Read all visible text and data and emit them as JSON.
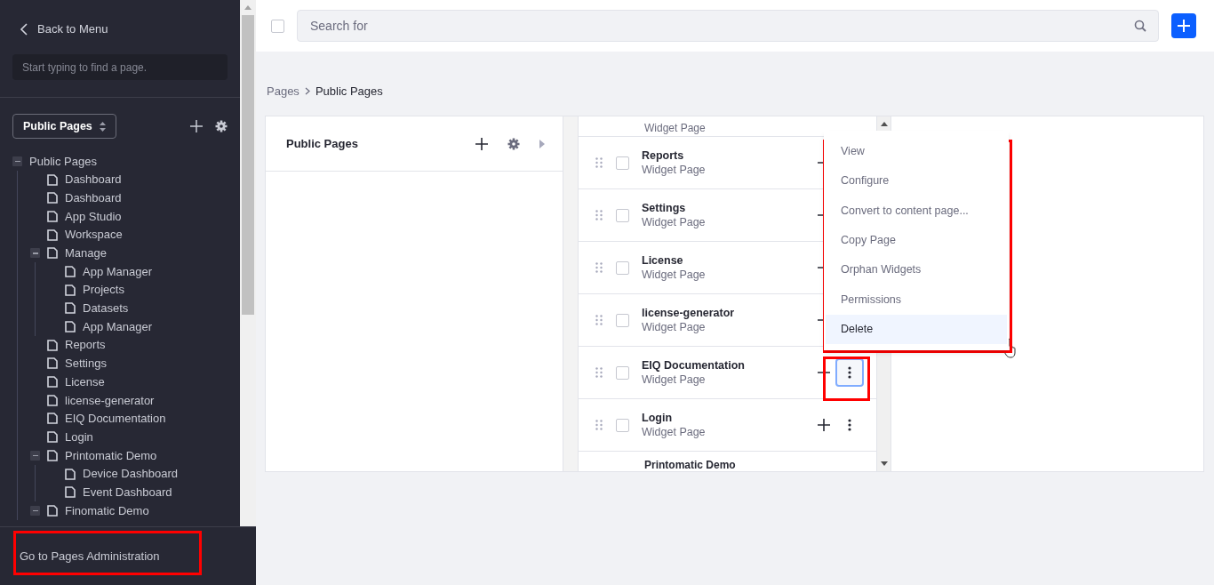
{
  "sidebar": {
    "back_link": "Back to Menu",
    "search": {
      "placeholder": "Start typing to find a page."
    },
    "site_selector": "Public Pages",
    "tree": [
      {
        "label": "Public Pages",
        "expanded": true,
        "children": [
          {
            "label": "Dashboard"
          },
          {
            "label": "Dashboard"
          },
          {
            "label": "App Studio"
          },
          {
            "label": "Workspace"
          },
          {
            "label": "Manage",
            "expanded": true,
            "children": [
              {
                "label": "App Manager"
              },
              {
                "label": "Projects"
              },
              {
                "label": "Datasets"
              },
              {
                "label": "App Manager"
              }
            ]
          },
          {
            "label": "Reports"
          },
          {
            "label": "Settings"
          },
          {
            "label": "License"
          },
          {
            "label": "license-generator"
          },
          {
            "label": "EIQ Documentation"
          },
          {
            "label": "Login"
          },
          {
            "label": "Printomatic Demo",
            "expanded": true,
            "children": [
              {
                "label": "Device Dashboard"
              },
              {
                "label": "Event Dashboard"
              }
            ]
          },
          {
            "label": "Finomatic Demo",
            "expanded": true
          }
        ]
      }
    ],
    "footer_link": "Go to Pages Administration"
  },
  "toolbar": {
    "select_all_checked": false,
    "search": {
      "placeholder": "Search for"
    }
  },
  "breadcrumb": [
    "Pages",
    "Public Pages"
  ],
  "columns": [
    {
      "title": "Public Pages"
    }
  ],
  "page_list": [
    {
      "kind": "partial-top",
      "subtitle": "Widget Page"
    },
    {
      "kind": "row",
      "title": "Reports",
      "subtitle": "Widget Page",
      "checked": false,
      "menu_open": false
    },
    {
      "kind": "row",
      "title": "Settings",
      "subtitle": "Widget Page",
      "checked": false,
      "menu_open": false
    },
    {
      "kind": "row",
      "title": "License",
      "subtitle": "Widget Page",
      "checked": false,
      "menu_open": false
    },
    {
      "kind": "row",
      "title": "license-generator",
      "subtitle": "Widget Page",
      "checked": false,
      "menu_open": false
    },
    {
      "kind": "row",
      "title": "EIQ Documentation",
      "subtitle": "Widget Page",
      "checked": false,
      "menu_open": true
    },
    {
      "kind": "row",
      "title": "Login",
      "subtitle": "Widget Page",
      "checked": false,
      "menu_open": false
    },
    {
      "kind": "partial-bottom",
      "title": "Printomatic Demo"
    }
  ],
  "context_menu": [
    {
      "label": "View",
      "selected": false
    },
    {
      "label": "Configure",
      "selected": false
    },
    {
      "label": "Convert to content page...",
      "selected": false
    },
    {
      "label": "Copy Page",
      "selected": false
    },
    {
      "label": "Orphan Widgets",
      "selected": false
    },
    {
      "label": "Permissions",
      "selected": false
    },
    {
      "label": "Delete",
      "selected": true
    }
  ]
}
